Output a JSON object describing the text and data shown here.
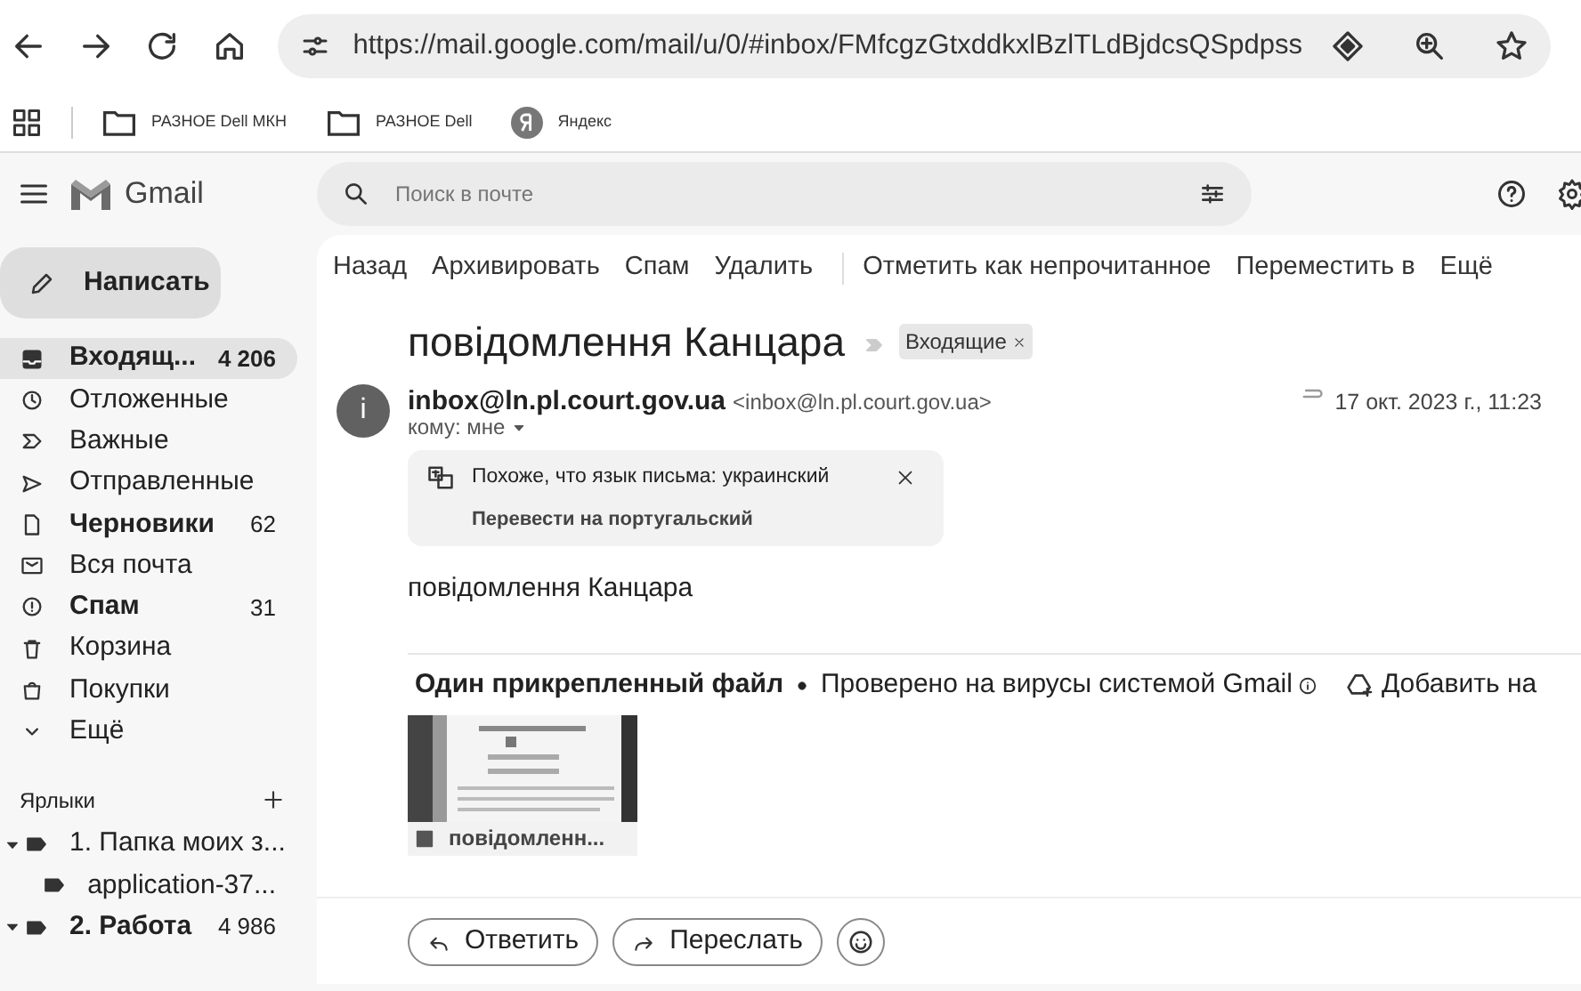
{
  "browser": {
    "url": "https://mail.google.com/mail/u/0/#inbox/FMfcgzGtxddkxlBzlTLdBjdcsQSpdpss",
    "bookmarks": [
      "РАЗНОЕ Dell МКН",
      "РАЗНОЕ Dell",
      "Яндекс"
    ]
  },
  "app": {
    "name": "Gmail"
  },
  "search": {
    "placeholder": "Поиск в почте"
  },
  "compose": "Написать",
  "folders": [
    {
      "label": "Входящ...",
      "count": "4 206",
      "bold": true,
      "selected": true
    },
    {
      "label": "Отложенные",
      "bold": false,
      "selected": false
    },
    {
      "label": "Важные",
      "bold": false,
      "selected": false
    },
    {
      "label": "Отправленные",
      "bold": false,
      "selected": false
    },
    {
      "label": "Черновики",
      "count": "62",
      "bold": true,
      "selected": false
    },
    {
      "label": "Вся почта",
      "bold": false,
      "selected": false
    },
    {
      "label": "Спам",
      "count": "31",
      "bold": true,
      "selected": false
    },
    {
      "label": "Корзина",
      "bold": false,
      "selected": false
    },
    {
      "label": "Покупки",
      "bold": false,
      "selected": false
    },
    {
      "label": "Ещё",
      "bold": false,
      "selected": false
    }
  ],
  "labels": {
    "title": "Ярлыки",
    "items": [
      {
        "label": "1. Папка моих з...",
        "bold": false,
        "expanded": true,
        "children": [
          {
            "label": "application-37...",
            "bold": false
          }
        ]
      },
      {
        "label": "2. Работа",
        "count": "4 986",
        "bold": true,
        "expanded": true
      }
    ]
  },
  "toolbar": [
    [
      "Назад",
      "Архивировать",
      "Спам",
      "Удалить"
    ],
    [
      "Отметить как непрочитанное",
      "Переместить в",
      "Ещё"
    ]
  ],
  "message": {
    "subject": "повідомлення Канцара",
    "label_chip": "Входящие",
    "sender_name": "inbox@ln.pl.court.gov.ua",
    "sender_email": "<inbox@ln.pl.court.gov.ua>",
    "avatar_letter": "i",
    "recipient": "кому: мне",
    "date": "17 окт. 2023 г., 11:23"
  },
  "translate": {
    "notice": "Похоже, что язык письма: украинский",
    "action": "Перевести на португальский"
  },
  "body": "повідомлення Канцара",
  "attachments": {
    "title": "Один прикрепленный файл",
    "scan_note": "Проверено на вирусы системой Gmail",
    "add_action": "Добавить на",
    "files": [
      {
        "name": "повідомленн..."
      }
    ]
  },
  "actions": [
    "Ответить",
    "Переслать"
  ]
}
